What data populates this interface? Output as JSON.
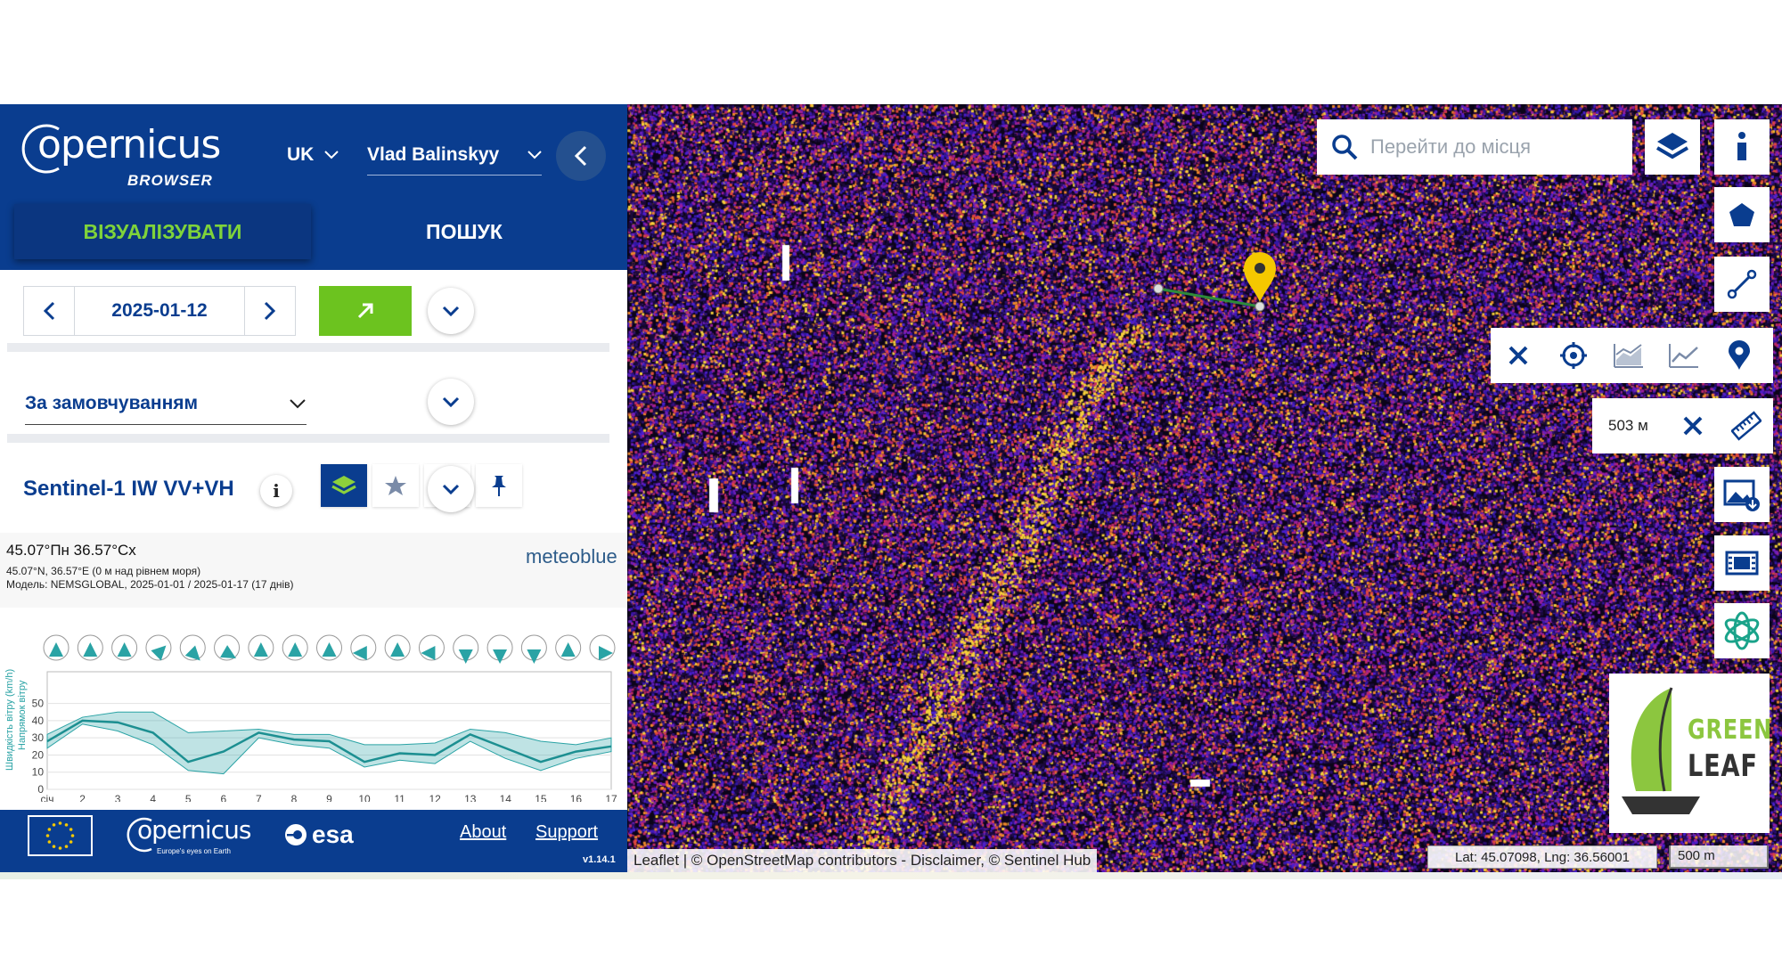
{
  "header": {
    "logo_word": "opernicus",
    "logo_initial": "C",
    "logo_sub": "BROWSER",
    "language": "UK",
    "user_name": "Vlad Balinskyy"
  },
  "tabs": {
    "visualize": "ВІЗУАЛІЗУВАТИ",
    "search": "ПОШУК"
  },
  "date": {
    "value": "2025-01-12"
  },
  "theme": {
    "selected": "За замовчуванням"
  },
  "layer": {
    "name": "Sentinel-1 IW VV+VH",
    "info": "i"
  },
  "meteo": {
    "title": "45.07°Пн 36.57°Сх",
    "coords": "45.07°N, 36.57°E (0 м над рівнем моря)",
    "model": "Модель: NEMSGLOBAL, 2025-01-01 / 2025-01-17 (17 днів)",
    "brand": "meteoblue",
    "ylabel_speed": "Швидкість вітру (km/h)",
    "ylabel_dir": "Напрямок вітру",
    "x_labels": [
      "січ",
      "2",
      "3",
      "4",
      "5",
      "6",
      "7",
      "8",
      "9",
      "10",
      "11",
      "12",
      "13",
      "14",
      "15",
      "16",
      "17"
    ],
    "y_ticks": [
      "50",
      "40",
      "30",
      "20",
      "10",
      "0"
    ]
  },
  "chart_data": {
    "type": "area",
    "x": [
      "січ",
      "2",
      "3",
      "4",
      "5",
      "6",
      "7",
      "8",
      "9",
      "10",
      "11",
      "12",
      "13",
      "14",
      "15",
      "16",
      "17"
    ],
    "ylabel": "Швидкість вітру (km/h)",
    "ylim": [
      0,
      55
    ],
    "series": [
      {
        "values": [
          28,
          40,
          39,
          33,
          16,
          22,
          33,
          29,
          28,
          16,
          21,
          20,
          32,
          24,
          16,
          22,
          25
        ]
      }
    ],
    "band_high": [
      32,
      42,
      45,
      45,
      33,
      34,
      35,
      32,
      32,
      26,
      26,
      27,
      35,
      33,
      28,
      26,
      30
    ],
    "band_low": [
      24,
      38,
      34,
      26,
      11,
      9,
      30,
      26,
      24,
      13,
      17,
      15,
      28,
      18,
      11,
      18,
      22
    ],
    "wind_direction_deg": [
      180,
      180,
      180,
      225,
      315,
      300,
      180,
      180,
      180,
      90,
      180,
      90,
      0,
      0,
      0,
      180,
      270
    ]
  },
  "footer": {
    "esa": "esa",
    "copernicus": "opernicus",
    "copernicus_initial": "C",
    "copernicus_sub": "Europe's eyes on Earth",
    "about": "About",
    "support": "Support",
    "version": "v1.14.1"
  },
  "map": {
    "search_placeholder": "Перейти до місця",
    "measure_value": "503 м",
    "attribution": "Leaflet | © OpenStreetMap contributors - Disclaimer, © Sentinel Hub",
    "latlng": "Lat: 45.07098, Lng: 36.56001",
    "scale": "500 m",
    "greenleaf_top": "GREEN",
    "greenleaf_bottom": "LEAF"
  },
  "colors": {
    "brand_blue": "#0a3d8f",
    "accent_green": "#6cc31f",
    "chart_teal": "#2aa3a5",
    "marker_yellow": "#f5c800"
  },
  "icons": [
    "chevron-left-icon",
    "chevron-right-icon",
    "open-external-icon",
    "chevron-down-icon",
    "info-icon",
    "layers-icon",
    "star-icon",
    "compare-icon",
    "pin-icon",
    "search-icon",
    "polygon-icon",
    "line-icon",
    "close-icon",
    "crosshair-icon",
    "area-chart-icon",
    "line-chart-icon",
    "location-pin-icon",
    "ruler-icon",
    "image-download-icon",
    "film-icon",
    "ai-flower-icon"
  ]
}
